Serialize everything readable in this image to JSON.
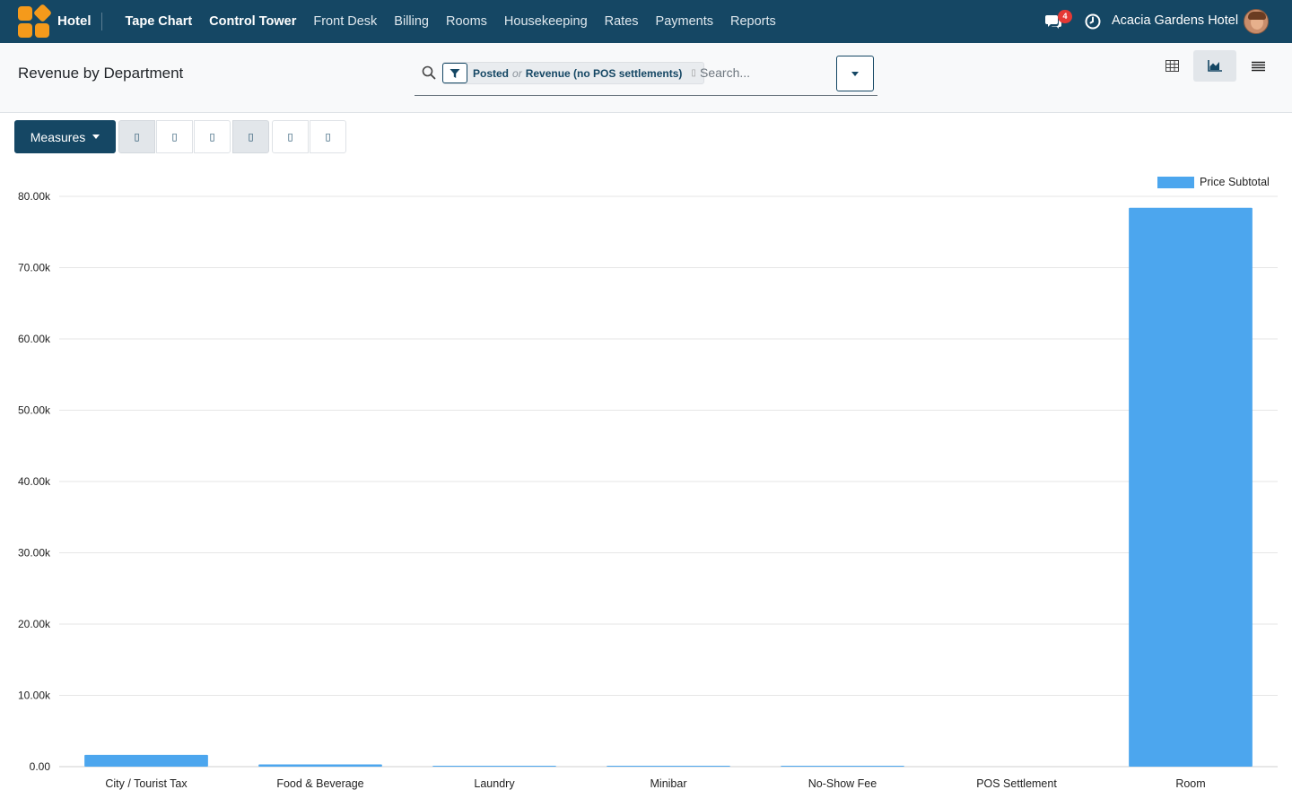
{
  "navbar": {
    "brand": "Hotel",
    "menu": [
      "Tape Chart",
      "Control Tower",
      "Front Desk",
      "Billing",
      "Rooms",
      "Housekeeping",
      "Rates",
      "Payments",
      "Reports"
    ],
    "strong_items": [
      "Tape Chart",
      "Control Tower"
    ],
    "message_count": "4",
    "company": "Acacia Gardens Hotel"
  },
  "control_panel": {
    "title": "Revenue by Department",
    "facet": {
      "first": "Posted",
      "separator": "or",
      "second": "Revenue (no POS settlements)"
    },
    "search_placeholder": "Search..."
  },
  "toolbar": {
    "measures_label": "Measures",
    "glyph": "▯"
  },
  "colors": {
    "nav": "#154764",
    "bar": "#4ca6ee"
  },
  "chart_data": {
    "type": "bar",
    "categories": [
      "City / Tourist Tax",
      "Food & Beverage",
      "Laundry",
      "Minibar",
      "No-Show Fee",
      "POS Settlement",
      "Room"
    ],
    "series": [
      {
        "name": "Price Subtotal",
        "values": [
          1650,
          310,
          40,
          50,
          100,
          0,
          78400
        ]
      }
    ],
    "y_ticks": [
      "0.00",
      "10.00k",
      "20.00k",
      "30.00k",
      "40.00k",
      "50.00k",
      "60.00k",
      "70.00k",
      "80.00k"
    ],
    "ylim": [
      0,
      80000
    ],
    "grid": true,
    "legend_position": "top-right"
  }
}
